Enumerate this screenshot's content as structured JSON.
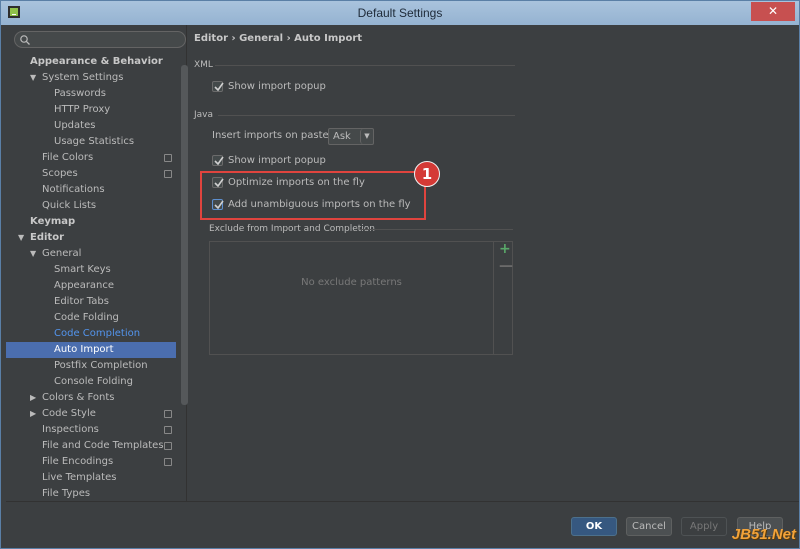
{
  "window": {
    "title": "Default Settings",
    "close_glyph": "✕"
  },
  "search": {
    "placeholder": ""
  },
  "sidebar": {
    "items": [
      {
        "label": "Appearance & Behavior",
        "level": 0,
        "bold": true,
        "arrow": ""
      },
      {
        "label": "System Settings",
        "level": 1,
        "arrow": "▼"
      },
      {
        "label": "Passwords",
        "level": 2
      },
      {
        "label": "HTTP Proxy",
        "level": 2
      },
      {
        "label": "Updates",
        "level": 2
      },
      {
        "label": "Usage Statistics",
        "level": 2
      },
      {
        "label": "File Colors",
        "level": 1,
        "project": true
      },
      {
        "label": "Scopes",
        "level": 1,
        "project": true
      },
      {
        "label": "Notifications",
        "level": 1
      },
      {
        "label": "Quick Lists",
        "level": 1
      },
      {
        "label": "Keymap",
        "level": 0,
        "bold": true
      },
      {
        "label": "Editor",
        "level": 0,
        "bold": true,
        "arrow": "▼"
      },
      {
        "label": "General",
        "level": 1,
        "arrow": "▼"
      },
      {
        "label": "Smart Keys",
        "level": 2
      },
      {
        "label": "Appearance",
        "level": 2
      },
      {
        "label": "Editor Tabs",
        "level": 2
      },
      {
        "label": "Code Folding",
        "level": 2
      },
      {
        "label": "Code Completion",
        "level": 2,
        "link": true
      },
      {
        "label": "Auto Import",
        "level": 2,
        "selected": true
      },
      {
        "label": "Postfix Completion",
        "level": 2
      },
      {
        "label": "Console Folding",
        "level": 2
      },
      {
        "label": "Colors & Fonts",
        "level": 1,
        "arrow": "▶"
      },
      {
        "label": "Code Style",
        "level": 1,
        "arrow": "▶",
        "project": true
      },
      {
        "label": "Inspections",
        "level": 1,
        "project": true
      },
      {
        "label": "File and Code Templates",
        "level": 1,
        "project": true
      },
      {
        "label": "File Encodings",
        "level": 1,
        "project": true
      },
      {
        "label": "Live Templates",
        "level": 1
      },
      {
        "label": "File Types",
        "level": 1
      }
    ]
  },
  "content": {
    "breadcrumb": "Editor › General › Auto Import",
    "xml": {
      "title": "XML",
      "show_import_popup": {
        "label": "Show import popup",
        "checked": true
      }
    },
    "java": {
      "title": "Java",
      "insert_label": "Insert imports on paste:",
      "insert_value": "Ask",
      "show_import_popup": {
        "label": "Show import popup",
        "checked": true
      },
      "optimize": {
        "label": "Optimize imports on the fly",
        "checked": true
      },
      "unambiguous": {
        "label": "Add unambiguous imports on the fly",
        "checked": true
      }
    },
    "annotation_number": "1",
    "exclude": {
      "title": "Exclude from Import and Completion",
      "empty_text": "No exclude patterns",
      "add_glyph": "+",
      "remove_glyph": "—"
    }
  },
  "footer": {
    "ok": "OK",
    "cancel": "Cancel",
    "apply": "Apply",
    "help": "Help"
  },
  "watermark": "JB51.Net",
  "colors": {
    "background": "#3c3f41",
    "selection": "#4b6eaf",
    "link": "#5394ec",
    "highlight_box": "#e0443e",
    "ok_button": "#365880"
  }
}
